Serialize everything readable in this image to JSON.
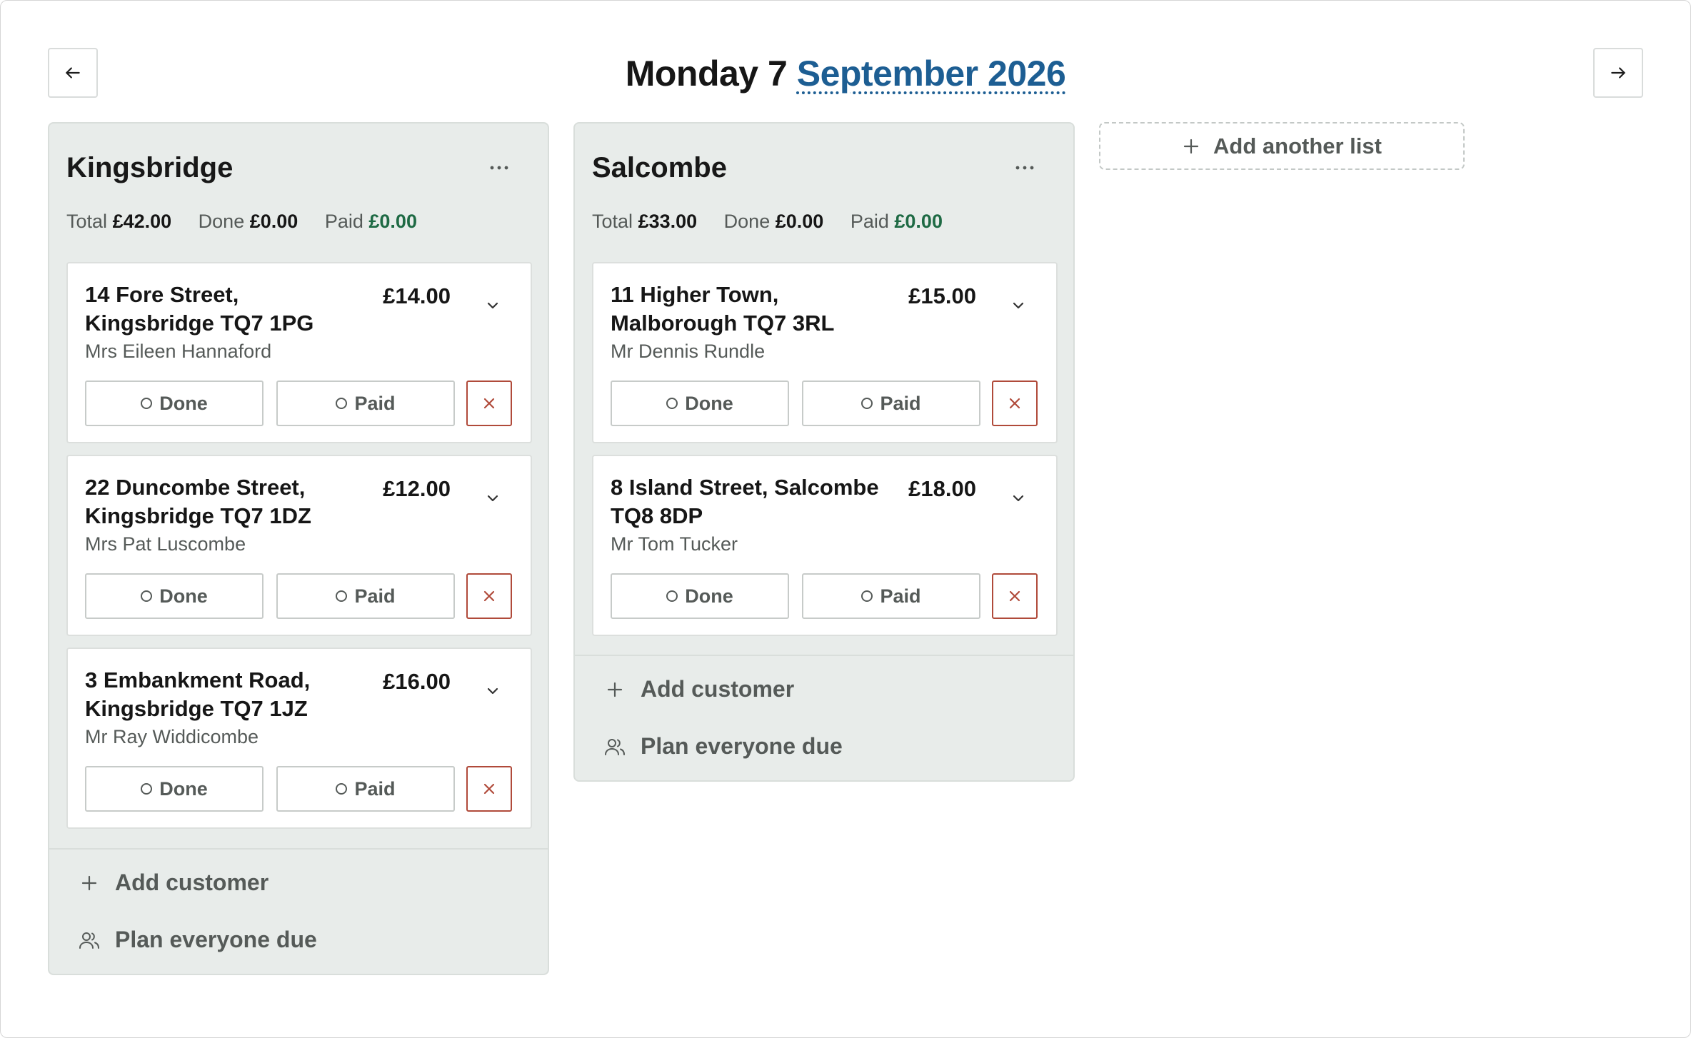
{
  "header": {
    "day_label": "Monday 7",
    "month_link": "September 2026",
    "prev_icon": "arrow-left-icon",
    "next_icon": "arrow-right-icon"
  },
  "lists": [
    {
      "title": "Kingsbridge",
      "menu_icon": "ellipsis-icon",
      "totals": {
        "total_label": "Total",
        "total_value": "£42.00",
        "done_label": "Done",
        "done_value": "£0.00",
        "paid_label": "Paid",
        "paid_value": "£0.00"
      },
      "cards": [
        {
          "address": "14 Fore Street, Kingsbridge TQ7 1PG",
          "price": "£14.00",
          "customer": "Mrs Eileen Hannaford",
          "done_label": "Done",
          "paid_label": "Paid"
        },
        {
          "address": "22 Duncombe Street, Kingsbridge TQ7 1DZ",
          "price": "£12.00",
          "customer": "Mrs Pat Luscombe",
          "done_label": "Done",
          "paid_label": "Paid"
        },
        {
          "address": "3 Embankment Road, Kingsbridge TQ7 1JZ",
          "price": "£16.00",
          "customer": "Mr Ray Widdicombe",
          "done_label": "Done",
          "paid_label": "Paid"
        }
      ],
      "add_customer_label": "Add customer",
      "plan_label": "Plan everyone due"
    },
    {
      "title": "Salcombe",
      "menu_icon": "ellipsis-icon",
      "totals": {
        "total_label": "Total",
        "total_value": "£33.00",
        "done_label": "Done",
        "done_value": "£0.00",
        "paid_label": "Paid",
        "paid_value": "£0.00"
      },
      "cards": [
        {
          "address": "11 Higher Town, Malborough TQ7 3RL",
          "price": "£15.00",
          "customer": "Mr Dennis Rundle",
          "done_label": "Done",
          "paid_label": "Paid"
        },
        {
          "address": "8 Island Street, Salcombe TQ8 8DP",
          "price": "£18.00",
          "customer": "Mr Tom Tucker",
          "done_label": "Done",
          "paid_label": "Paid"
        }
      ],
      "add_customer_label": "Add customer",
      "plan_label": "Plan everyone due"
    }
  ],
  "add_list_label": "Add another list",
  "colors": {
    "accent_link": "#1d5e93",
    "paid_green": "#1e6a44",
    "remove_red": "#b04a3a",
    "list_bg": "#e8ecea"
  }
}
